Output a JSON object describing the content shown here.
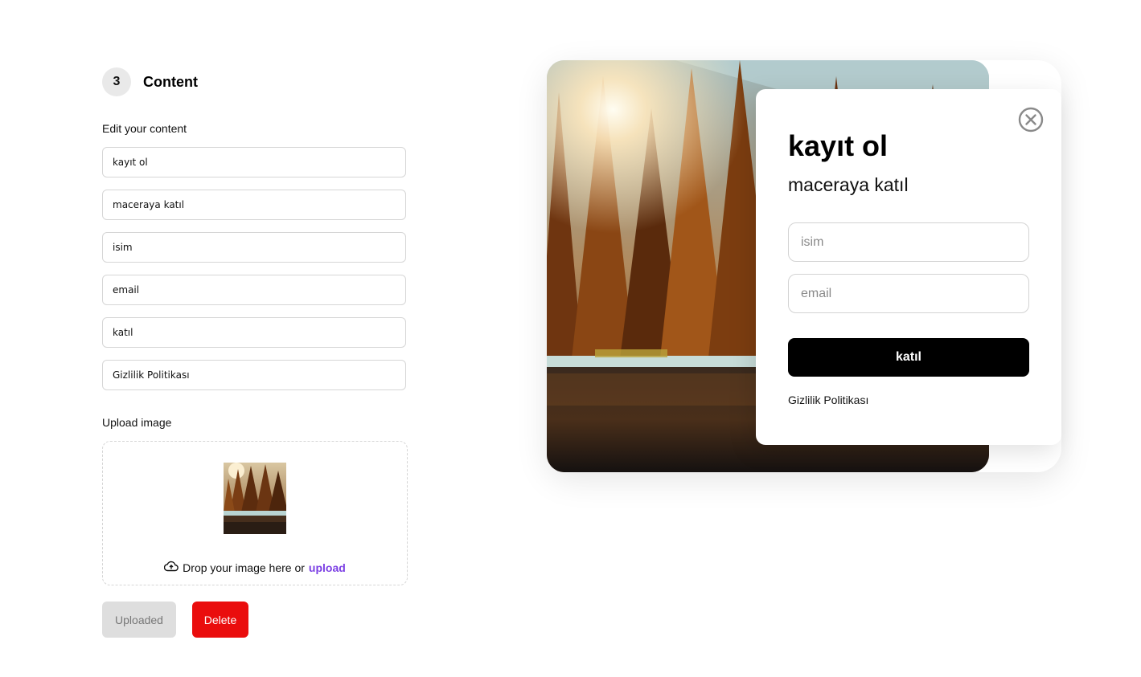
{
  "step": {
    "number": "3",
    "title": "Content"
  },
  "edit_label": "Edit your content",
  "fields": [
    {
      "value": "kayıt ol"
    },
    {
      "value": "maceraya katıl"
    },
    {
      "value": "isim"
    },
    {
      "value": "email"
    },
    {
      "value": "katıl"
    },
    {
      "value": "Gizlilik Politikası"
    }
  ],
  "upload": {
    "label": "Upload image",
    "drop_text": "Drop your image here or",
    "link_text": "upload",
    "icon": "cloud-upload-icon"
  },
  "buttons": {
    "uploaded": "Uploaded",
    "delete": "Delete"
  },
  "popup": {
    "title": "kayıt ol",
    "subtitle": "maceraya katıl",
    "name_placeholder": "isim",
    "email_placeholder": "email",
    "submit": "katıl",
    "privacy": "Gizlilik Politikası",
    "close_icon": "close-circle-icon"
  },
  "colors": {
    "accent_link": "#7b3fe4",
    "delete": "#ea0d0d",
    "popup_button": "#000000"
  }
}
